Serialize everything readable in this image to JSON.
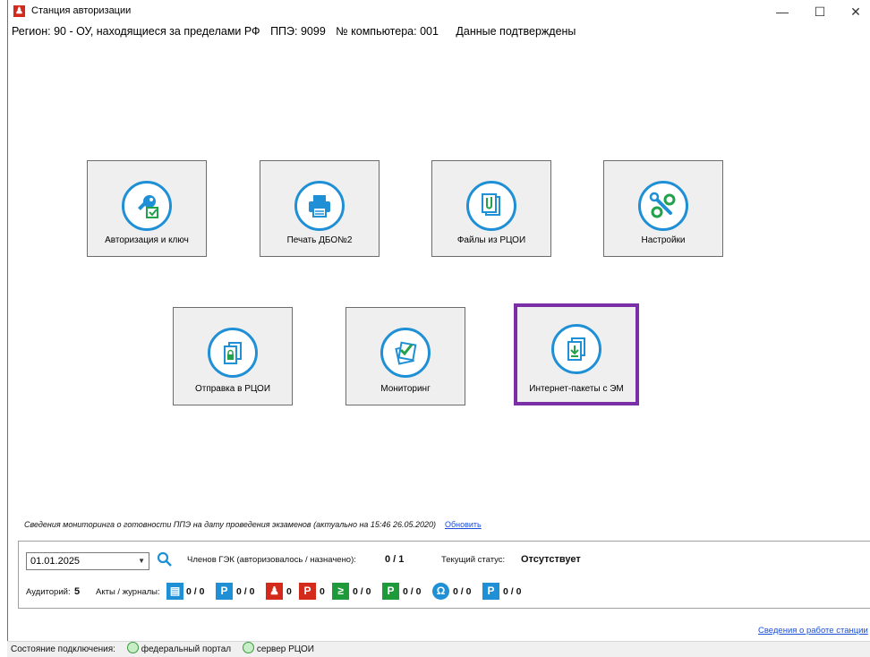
{
  "window": {
    "title": "Станция авторизации",
    "minimize": "—",
    "maximize": "☐",
    "close": "✕"
  },
  "info": {
    "region": "Регион: 90 - ОУ, находящиеся за пределами РФ",
    "ppe": "ППЭ: 9099",
    "computer": "№ компьютера: 001",
    "status": "Данные подтверждены"
  },
  "tiles": [
    {
      "label": "Авторизация и ключ",
      "icon": "key-icon"
    },
    {
      "label": "Печать ДБО№2",
      "icon": "printer-icon"
    },
    {
      "label": "Файлы из РЦОИ",
      "icon": "files-icon"
    },
    {
      "label": "Настройки",
      "icon": "wrench-gear-icon"
    },
    {
      "label": "Отправка в РЦОИ",
      "icon": "lock-document-icon"
    },
    {
      "label": "Мониторинг",
      "icon": "checklist-icon"
    },
    {
      "label": "Интернет-пакеты с ЭМ",
      "icon": "download-package-icon"
    }
  ],
  "monitoring": {
    "text": "Сведения мониторинга о готовности ППЭ на дату проведения экзаменов (актуально на 15:46 26.05.2020)",
    "refresh": "Обновить"
  },
  "panel": {
    "date": "01.01.2025",
    "gek_label": "Членов ГЭК (авторизовалось / назначено):",
    "gek_value": "0 / 1",
    "status_label": "Текущий статус:",
    "status_value": "Отсутствует",
    "auditoriums_label": "Аудиторий:",
    "auditoriums_value": "5",
    "acts_label": "Акты / журналы:",
    "counters": [
      "0 / 0",
      "0 / 0",
      "0",
      "0",
      "0 / 0",
      "0 / 0",
      "0 / 0",
      "0 / 0"
    ],
    "colors": {
      "blue": "#1f8fd6",
      "red": "#d42a1c",
      "green": "#1f9a3a"
    }
  },
  "footer": {
    "link": "Сведения о работе станции",
    "connection_label": "Состояние подключения:",
    "federal": "федеральный портал",
    "rcoi": "сервер РЦОИ"
  }
}
